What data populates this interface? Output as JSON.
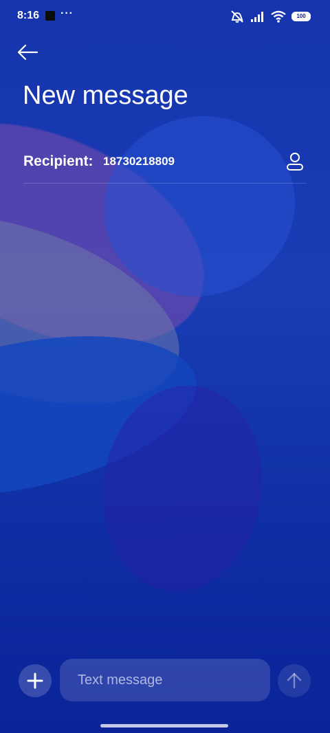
{
  "status_bar": {
    "time": "8:16",
    "dots": "···",
    "battery": "100",
    "icons": [
      "notification-square-icon",
      "mute-icon",
      "signal-icon",
      "wifi-icon",
      "battery-icon"
    ]
  },
  "header": {
    "title": "New message",
    "back_icon": "arrow-left-icon"
  },
  "recipient": {
    "label": "Recipient:",
    "value": "18730218809",
    "contact_icon": "person-icon"
  },
  "composer": {
    "placeholder": "Text message",
    "add_icon": "plus-icon",
    "send_icon": "arrow-up-icon"
  },
  "colors": {
    "background": "#0b239c",
    "text": "#ffffff"
  }
}
